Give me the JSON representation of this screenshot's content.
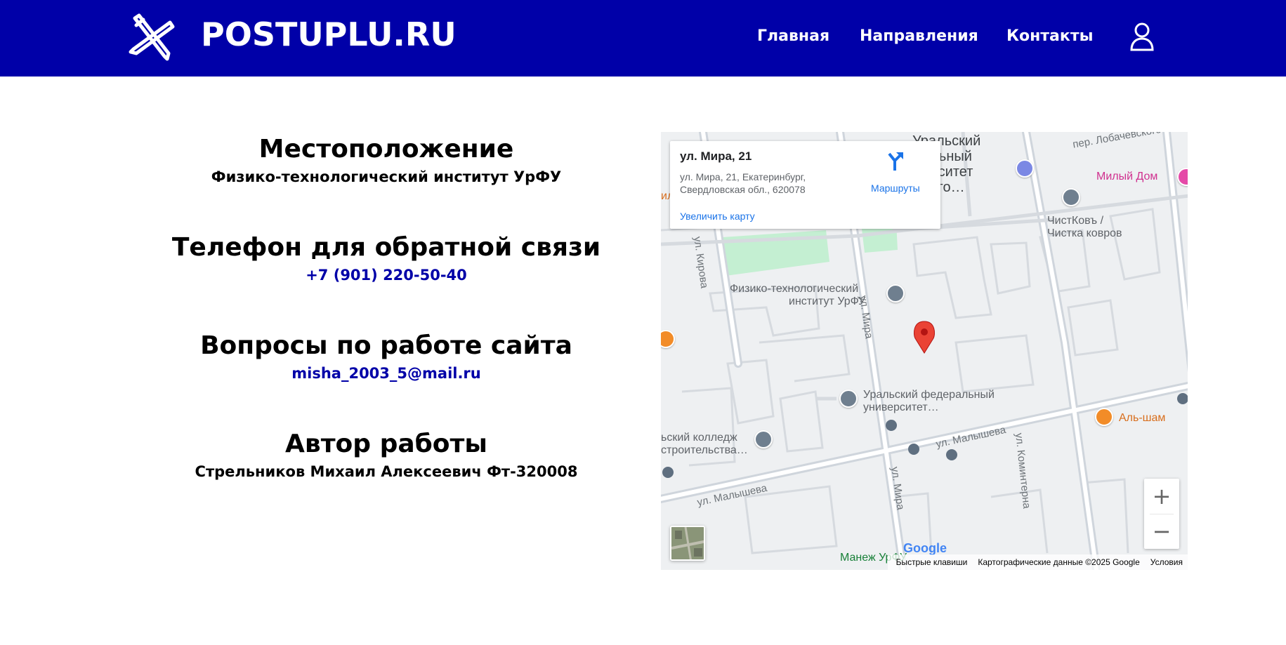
{
  "header": {
    "brand": "POSTUPLU.RU",
    "nav": [
      "Главная",
      "Направления",
      "Контакты"
    ],
    "logo_icon": "crossed-pencils-icon",
    "user_icon": "user-icon",
    "background": "#0000a8"
  },
  "contacts": {
    "location": {
      "title": "Местоположение",
      "text": "Физико-технологический институт УрФУ"
    },
    "phone": {
      "title": "Телефон для обратной связи",
      "value": "+7 (901) 220-50-40"
    },
    "site_questions": {
      "title": "Вопросы по работе сайта",
      "value": "misha_2003_5@mail.ru"
    },
    "author": {
      "title": "Автор работы",
      "text": "Стрельников Михаил Алексеевич Фт-320008"
    }
  },
  "map": {
    "info_card": {
      "title": "ул. Мира, 21",
      "address_line1": "ул. Мира, 21, Екатеринбург,",
      "address_line2": "Свердловская обл., 620078",
      "enlarge_link": "Увеличить карту",
      "route_label": "Маршруты"
    },
    "labels": {
      "urfu_top_1": "Уральский",
      "urfu_top_2": "ральный",
      "urfu_top_3": "верситет",
      "urfu_top_4": "рвого…",
      "lobachevsky": "пер. Лобачевского",
      "mily_dom": "Милый Дом",
      "chistkov_1": "ЧистКовъ /",
      "chistkov_2": "Чистка ковров",
      "kirova": "ул. Кирова",
      "fti_1": "Физико-технологический",
      "fti_2": "институт УрФУ",
      "mira_1": "ул. Мира",
      "urfu_1": "Уральский федеральный",
      "urfu_2": "университет…",
      "college_1": "ьский колледж",
      "college_2": "строительства…",
      "malysheva_1": "ул. Малышева",
      "malysheva_2": "ул. Малышева",
      "mira_2": "ул. Мира",
      "kominterna": "ул. Коминтерна",
      "al_sham": "Аль-шам",
      "manezh": "Манеж УрФУ",
      "il": "ил"
    },
    "google": "Google",
    "attribution": {
      "shortcuts": "Быстрые клавиши",
      "data": "Картографические данные ©2025 Google",
      "terms": "Условия"
    },
    "zoom_in": "+",
    "zoom_out": "−"
  }
}
